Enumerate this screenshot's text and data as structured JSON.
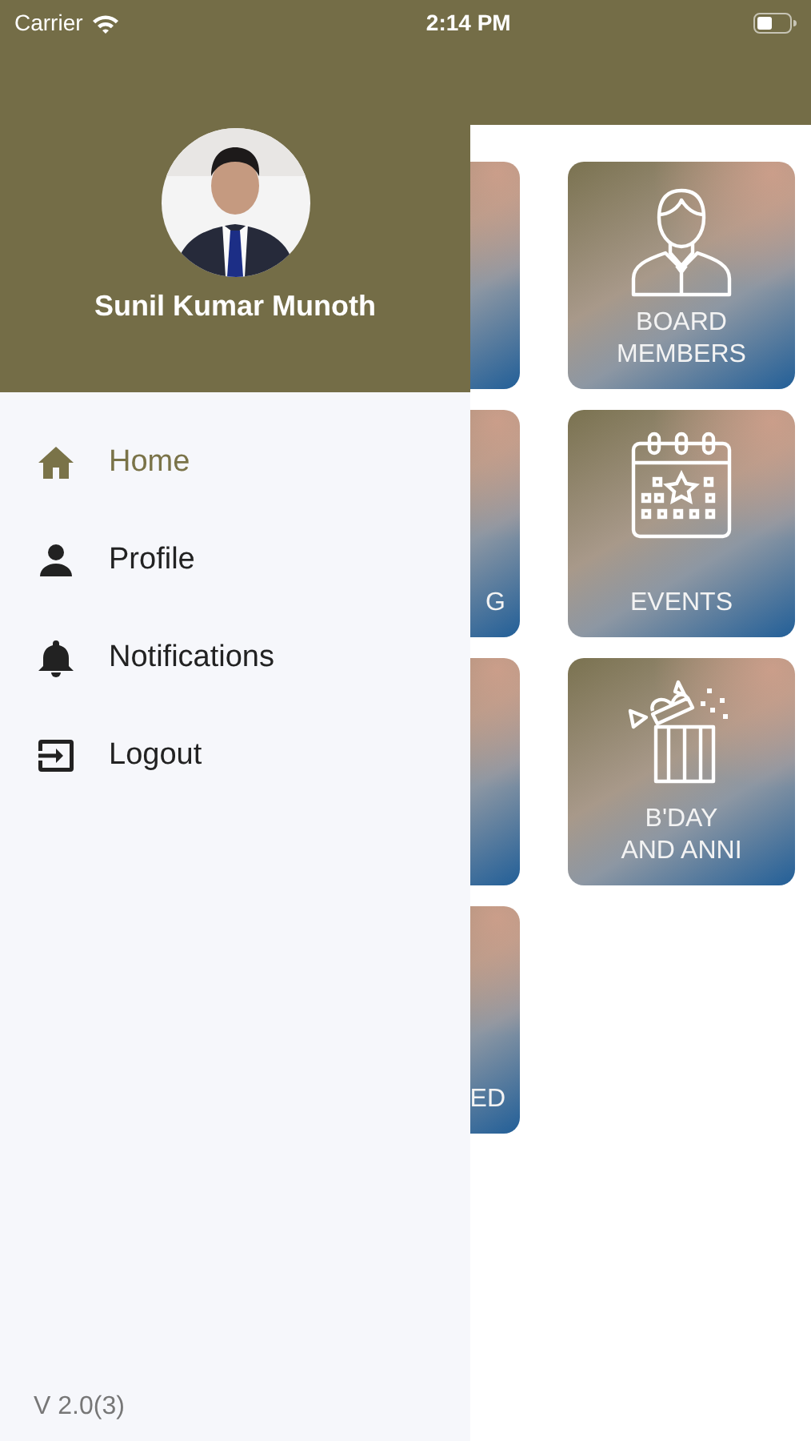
{
  "status_bar": {
    "carrier": "Carrier",
    "time": "2:14 PM"
  },
  "tiles": [
    {
      "kind": "cut"
    },
    {
      "kind": "members",
      "label": "BOARD\nMEMBERS"
    },
    {
      "kind": "cut",
      "label": "G"
    },
    {
      "kind": "events",
      "label": "EVENTS"
    },
    {
      "kind": "cut"
    },
    {
      "kind": "greetings",
      "label": "B'DAY\nAND ANNI"
    },
    {
      "kind": "cut",
      "label": "ED"
    }
  ],
  "drawer": {
    "user_name": "Sunil Kumar Munoth",
    "items": [
      {
        "label": "Home",
        "selected": true
      },
      {
        "label": "Profile",
        "selected": false
      },
      {
        "label": "Notifications",
        "selected": false
      },
      {
        "label": "Logout",
        "selected": false
      }
    ],
    "version": "V 2.0(3)"
  }
}
